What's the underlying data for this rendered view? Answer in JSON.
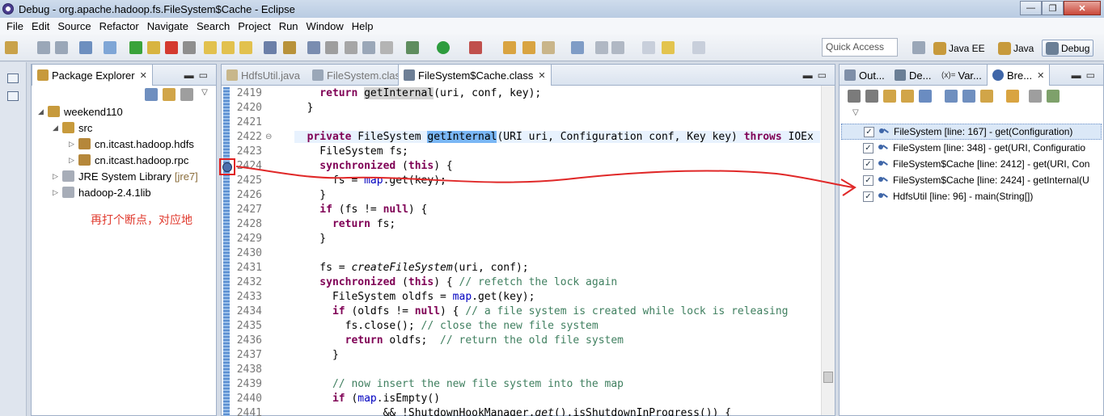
{
  "window": {
    "title": "Debug - org.apache.hadoop.fs.FileSystem$Cache - Eclipse",
    "minimize": "—",
    "maximize": "❐",
    "close": "✕"
  },
  "menu": [
    "File",
    "Edit",
    "Source",
    "Refactor",
    "Navigate",
    "Search",
    "Project",
    "Run",
    "Window",
    "Help"
  ],
  "toolbar": {
    "quick_access": "Quick Access",
    "perspectives": [
      "Java EE",
      "Java",
      "Debug"
    ]
  },
  "package_explorer": {
    "title": "Package Explorer",
    "tree": [
      {
        "label": "weekend110",
        "deco": ""
      },
      {
        "label": "src",
        "deco": ""
      },
      {
        "label": "cn.itcast.hadoop.hdfs",
        "deco": ""
      },
      {
        "label": "cn.itcast.hadoop.rpc",
        "deco": ""
      },
      {
        "label": "JRE System Library",
        "deco": "[jre7]"
      },
      {
        "label": "hadoop-2.4.1lib",
        "deco": ""
      }
    ],
    "annotation": "再打个断点，对应地"
  },
  "editor": {
    "tabs": [
      "HdfsUtil.java",
      "FileSystem.class",
      "FileSystem$Cache.class"
    ],
    "line_numbers": [
      "2419",
      "2420",
      "2421",
      "2422",
      "2423",
      "2424",
      "2425",
      "2426",
      "2427",
      "2428",
      "2429",
      "2430",
      "2431",
      "2432",
      "2433",
      "2434",
      "2435",
      "2436",
      "2437",
      "2438",
      "2439",
      "2440",
      "2441"
    ],
    "code": {
      "l2419_a": "    return ",
      "l2419_b": "getInternal",
      "l2419_c": "(uri, conf, key);",
      "l2420": "  }",
      "l2422_kw1": "  private",
      "l2422_a": " FileSystem ",
      "l2422_hl": "getInternal",
      "l2422_b": "(URI uri, Configuration conf, Key key) ",
      "l2422_kw2": "throws",
      "l2422_c": " IOEx",
      "l2423": "    FileSystem fs;",
      "l2424_kw": "    synchronized",
      "l2424_a": " (",
      "l2424_kw2": "this",
      "l2424_b": ") {",
      "l2425_a": "      fs = ",
      "l2425_f": "map",
      "l2425_b": ".get(key);",
      "l2426": "    }",
      "l2427_kw": "    if",
      "l2427_a": " (fs != ",
      "l2427_kw2": "null",
      "l2427_b": ") {",
      "l2428_kw": "      return",
      "l2428_a": " fs;",
      "l2429": "    }",
      "l2431_a": "    fs = ",
      "l2431_i": "createFileSystem",
      "l2431_b": "(uri, conf);",
      "l2432_kw": "    synchronized",
      "l2432_a": " (",
      "l2432_kw2": "this",
      "l2432_b": ") { ",
      "l2432_cm": "// refetch the lock again",
      "l2433_a": "      FileSystem oldfs = ",
      "l2433_f": "map",
      "l2433_b": ".get(key);",
      "l2434_kw": "      if",
      "l2434_a": " (oldfs != ",
      "l2434_kw2": "null",
      "l2434_b": ") { ",
      "l2434_cm": "// a file system is created while lock is releasing",
      "l2435_a": "        fs.close(); ",
      "l2435_cm": "// close the new file system",
      "l2436_kw": "        return",
      "l2436_a": " oldfs;  ",
      "l2436_cm": "// return the old file system",
      "l2437": "      }",
      "l2439_cm": "      // now insert the new file system into the map",
      "l2440_kw": "      if",
      "l2440_a": " (",
      "l2440_f": "map",
      "l2440_b": ".isEmpty()",
      "l2441_a": "              && !ShutdownHookManager.",
      "l2441_i": "get",
      "l2441_b": "().isShutdownInProgress()) {"
    }
  },
  "right_panel": {
    "tabs": [
      "Out...",
      "De...",
      "Var...",
      "Bre..."
    ],
    "var_prefix": "(x)=",
    "breakpoints": [
      "FileSystem [line: 167] - get(Configuration)",
      "FileSystem [line: 348] - get(URI, Configuratio",
      "FileSystem$Cache [line: 2412] - get(URI, Con",
      "FileSystem$Cache [line: 2424] - getInternal(U",
      "HdfsUtil [line: 96] - main(String[])"
    ],
    "check": "✓"
  },
  "colors": {
    "annotation_red": "#e03a2e",
    "keyword": "#7f0055",
    "comment": "#3f7f5f",
    "field": "#0000c0",
    "selection": "#7ab7f5"
  }
}
